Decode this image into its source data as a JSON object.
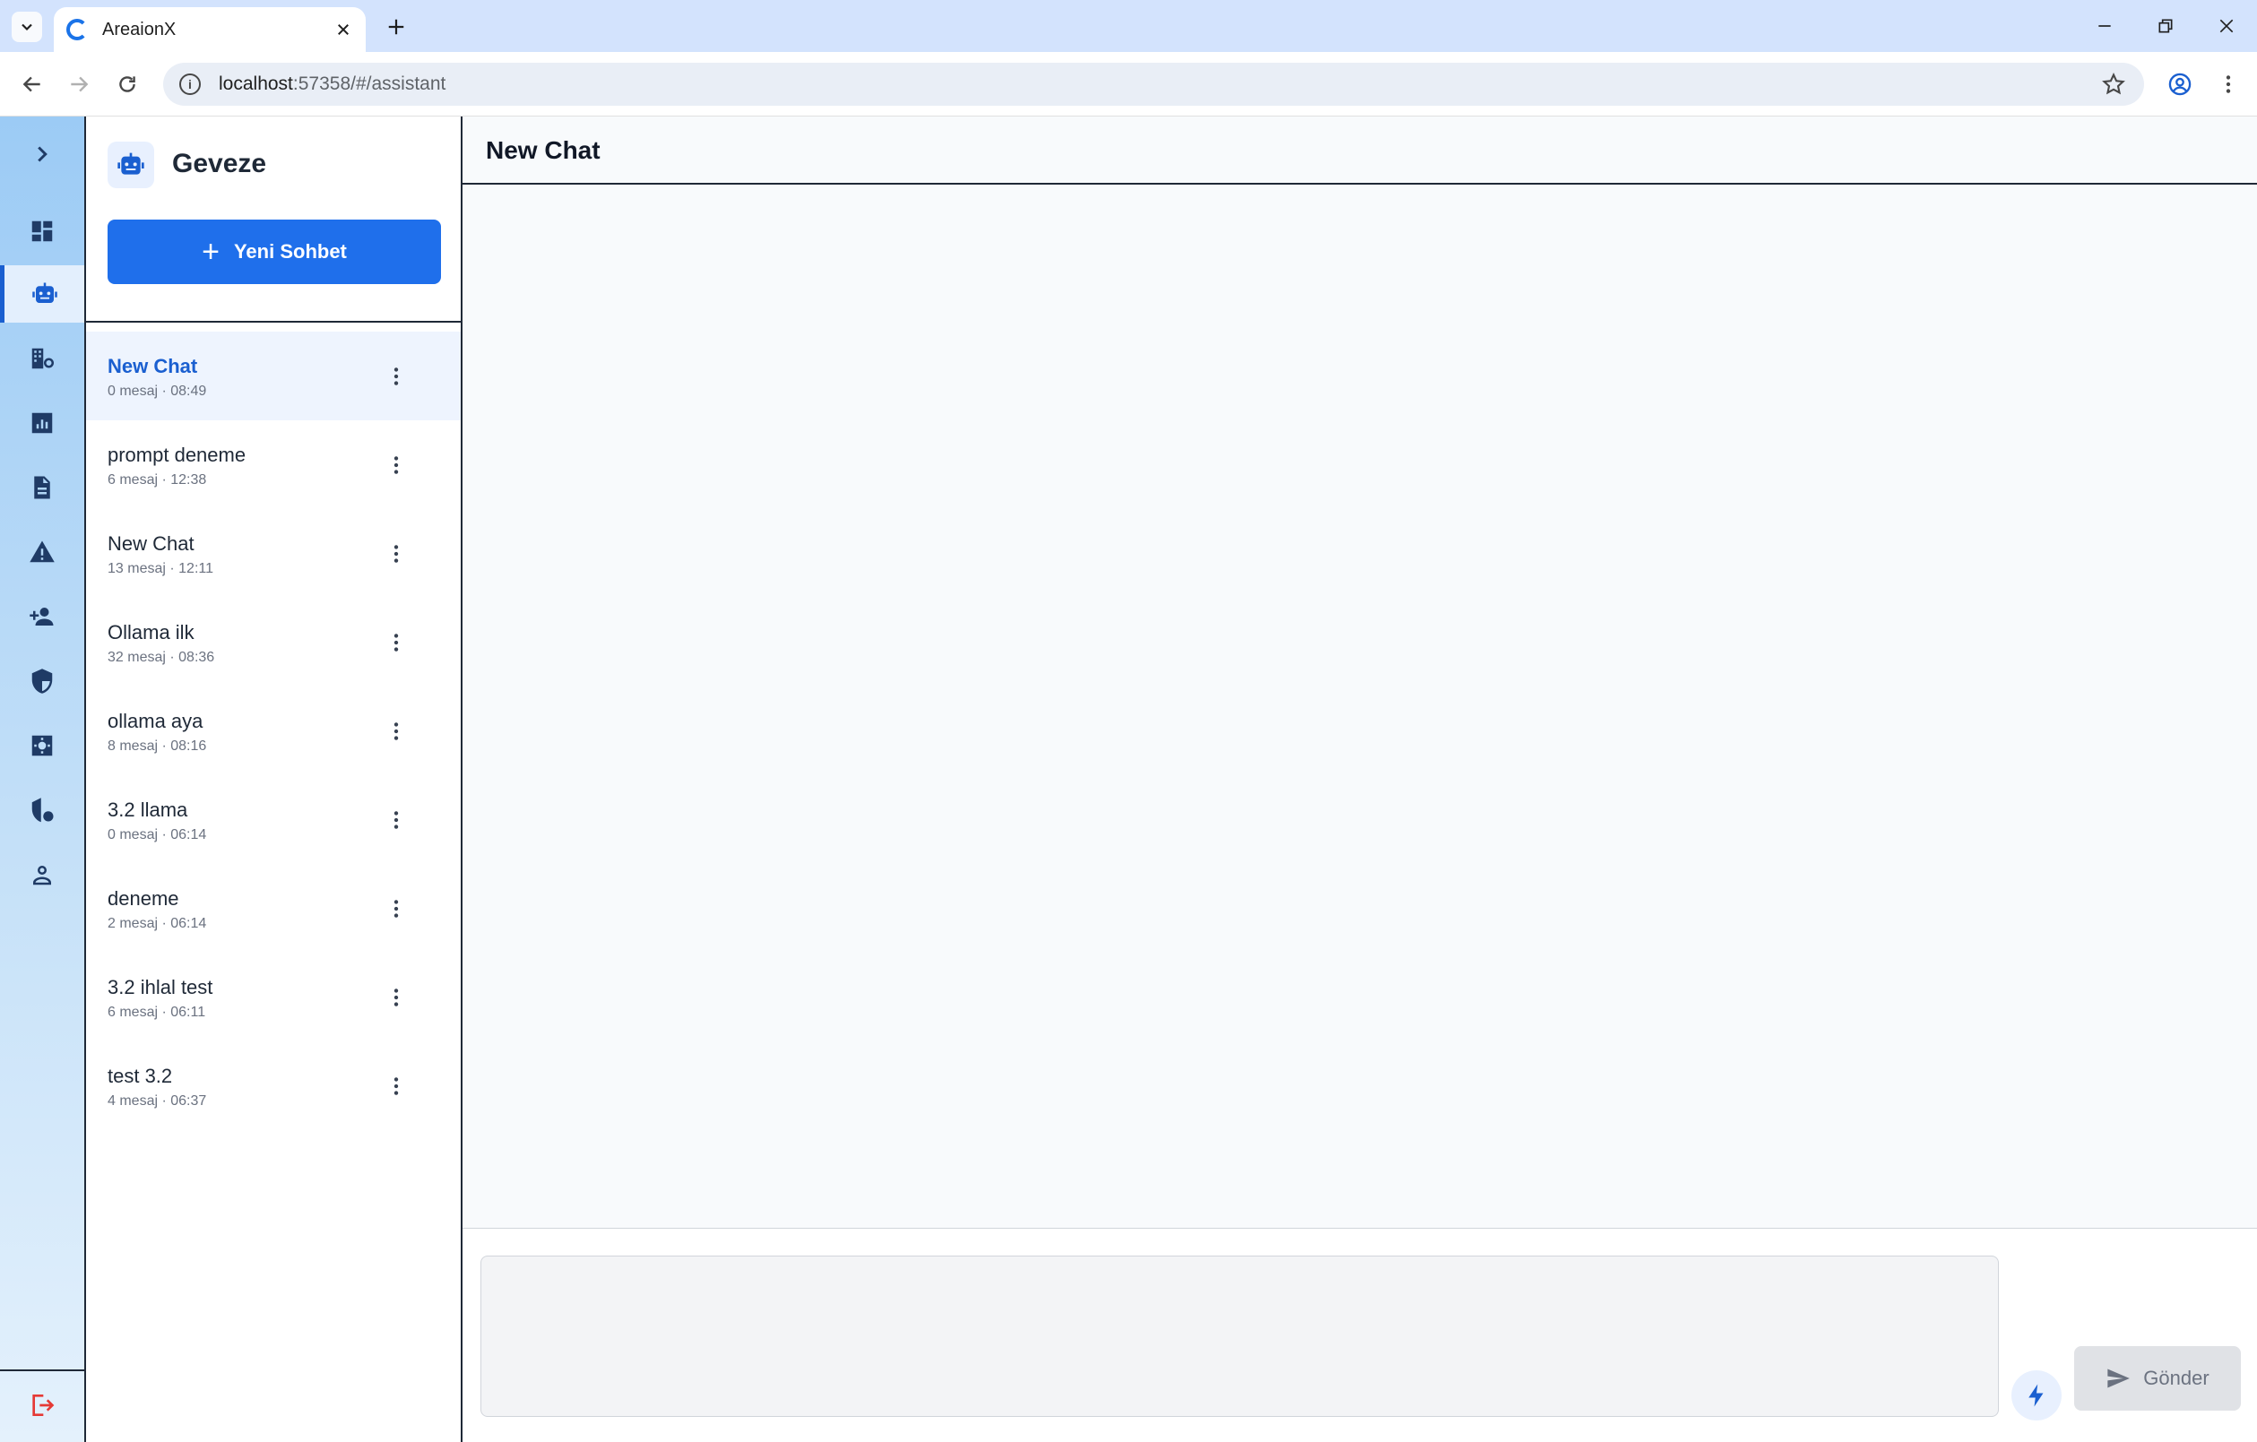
{
  "browser": {
    "tab_title": "AreaionX",
    "url_host": "localhost",
    "url_rest": ":57358/#/assistant"
  },
  "rail": {
    "items": [
      {
        "icon": "chevron-right-icon"
      },
      {
        "icon": "dashboard-icon"
      },
      {
        "icon": "robot-icon",
        "active": true
      },
      {
        "icon": "building-settings-icon"
      },
      {
        "icon": "bar-chart-icon"
      },
      {
        "icon": "document-icon"
      },
      {
        "icon": "warning-icon"
      },
      {
        "icon": "add-person-icon"
      },
      {
        "icon": "shield-icon"
      },
      {
        "icon": "settings-icon"
      },
      {
        "icon": "security-policy-icon"
      },
      {
        "icon": "user-icon"
      }
    ],
    "logout_icon": "logout-icon",
    "logout_color": "#e53935"
  },
  "sidebar": {
    "title": "Geveze",
    "new_chat_label": "Yeni Sohbet",
    "conversations": [
      {
        "title": "New Chat",
        "meta": "0 mesaj · 08:49",
        "active": true
      },
      {
        "title": "prompt deneme",
        "meta": "6 mesaj · 12:38"
      },
      {
        "title": "New Chat",
        "meta": "13 mesaj · 12:11"
      },
      {
        "title": "Ollama ilk",
        "meta": "32 mesaj · 08:36"
      },
      {
        "title": "ollama aya",
        "meta": "8 mesaj · 08:16"
      },
      {
        "title": "3.2 llama",
        "meta": "0 mesaj · 06:14"
      },
      {
        "title": "deneme",
        "meta": "2 mesaj · 06:14"
      },
      {
        "title": "3.2 ihlal test",
        "meta": "6 mesaj · 06:11"
      },
      {
        "title": "test 3.2",
        "meta": "4 mesaj · 06:37"
      }
    ]
  },
  "chat": {
    "title": "New Chat",
    "input_value": "",
    "send_label": "Gönder"
  },
  "colors": {
    "accent": "#1f6feb",
    "rail_top": "#9ccbf5",
    "rail_bottom": "#e4f1fc",
    "active_item_bg": "#eef4fe"
  }
}
